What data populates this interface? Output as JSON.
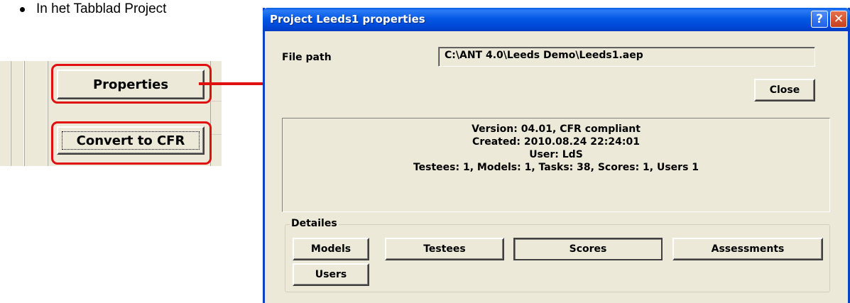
{
  "doc": {
    "bullet_text": "In het Tabblad Project"
  },
  "toolbar": {
    "properties_label": "Properties",
    "convert_label": "Convert to CFR"
  },
  "dialog": {
    "title": "Project Leeds1 properties",
    "help_glyph": "?",
    "close_glyph": "✕",
    "file_path_label": "File path",
    "file_path_value": "C:\\ANT 4.0\\Leeds Demo\\Leeds1.aep",
    "close_label": "Close",
    "info": {
      "version": "Version: 04.01, CFR compliant",
      "created": "Created: 2010.08.24 22:24:01",
      "user": "User: LdS",
      "counts": "Testees: 1, Models: 1, Tasks: 38, Scores: 1, Users 1"
    },
    "details": {
      "title": "Detailes",
      "models": "Models",
      "testees": "Testees",
      "scores": "Scores",
      "assessments": "Assessments",
      "users": "Users"
    }
  },
  "colors": {
    "highlight": "#e01010",
    "titlebar": "#0559e4",
    "dialog_bg": "#ece9d8"
  }
}
